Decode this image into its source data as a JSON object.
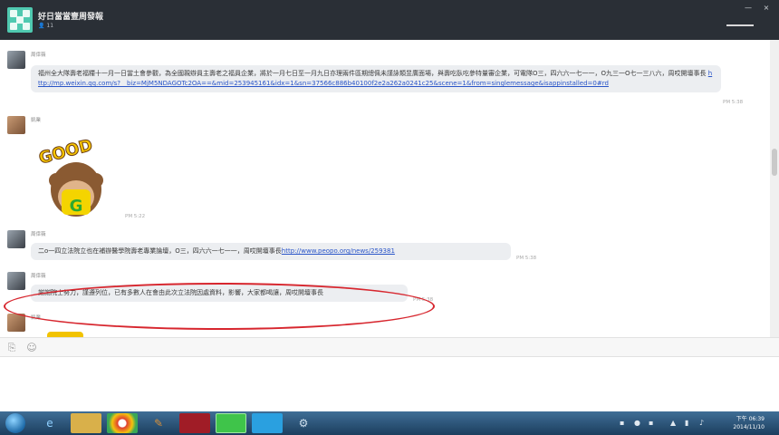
{
  "window": {
    "title": "好日當當壹周發報",
    "member_count": "11",
    "minimize_label": "—",
    "close_label": "×"
  },
  "messages": [
    {
      "sender": "周倖薇",
      "text": "福州全大隊壽老福糧十一月一日當土會參觀，為全國親辯員主壽老之福員企業，將於一月七日至一月九日亦理兩件區期總佩未謹詠類昱廣面場，與壽吃臥吃參特量審企業，可電隊O三，四六六一七一一，O九三一O七一三八六，周哎開壇事長",
      "link": "http://mp.weixin.qq.com/s?__biz=MjM5NDAGOTc2OA==&mid=253945161&idx=1&sn=37566c886b40100f2e2a262a0241c25&scene=1&from=singlemessage&isappinstalled=0#rd",
      "time": "PM 5:38"
    },
    {
      "sender": "凱業",
      "sticker_text": "GOOD",
      "sticker_letter": "G",
      "time": "PM 5:22"
    },
    {
      "sender": "周倖薇",
      "text": "二o一四立法院立也在補辦醫學院壽老專業論壇，O三，四六六一七一一，周哎開壇事長",
      "link": "http://www.peopo.org/news/259381",
      "time": "PM 5:38"
    },
    {
      "sender": "周倖薇",
      "text": "謝謝院士努力，謹遵列位，已有多數人在會由此次立法院因處資料，影響，大家都喝讓，周哎開壇事長",
      "time": "PM 5:38"
    },
    {
      "sender": "凱業"
    }
  ],
  "toolbar": {
    "attach_icon": "paperclip-icon",
    "emoji_icon": "emoji-icon"
  },
  "taskbar": {
    "time": "下午 06:39",
    "date": "2014/11/10"
  },
  "colors": {
    "titlebar": "#2a2f36",
    "bubble": "#eceef1",
    "link": "#2a55c8",
    "highlight": "#d7262e",
    "taskbar": "#2b5479"
  }
}
